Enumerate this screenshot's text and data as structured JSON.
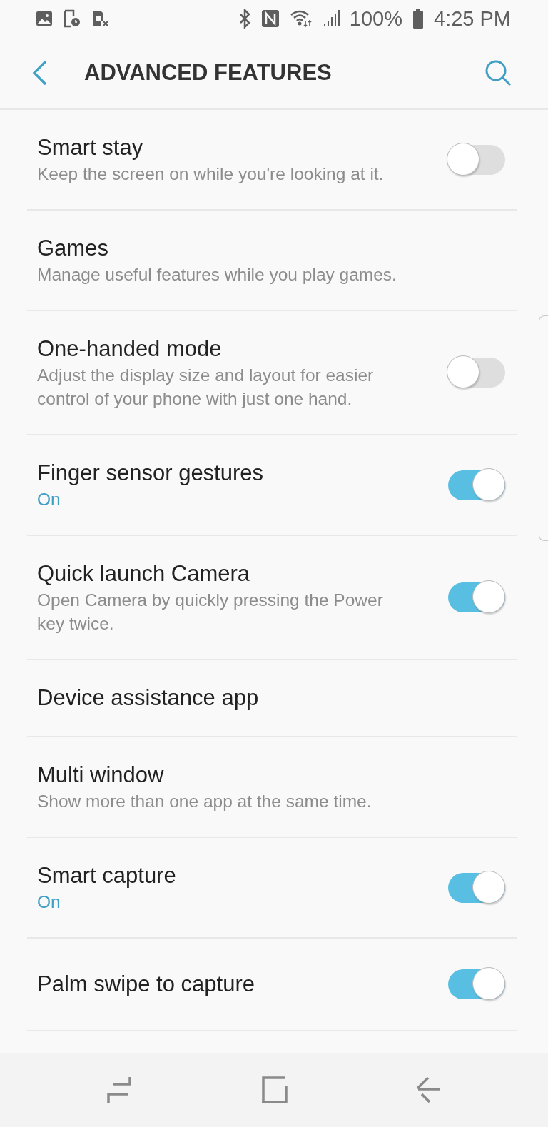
{
  "status_bar": {
    "battery_text": "100%",
    "time": "4:25 PM"
  },
  "header": {
    "title": "ADVANCED FEATURES"
  },
  "settings": [
    {
      "kind": "switch",
      "title": "Smart stay",
      "subtitle": "Keep the screen on while you're looking at it.",
      "on": false,
      "divider": true
    },
    {
      "kind": "link",
      "title": "Games",
      "subtitle": "Manage useful features while you play games."
    },
    {
      "kind": "switch",
      "title": "One-handed mode",
      "subtitle": "Adjust the display size and layout for easier control of your phone with just one hand.",
      "on": false,
      "divider": true
    },
    {
      "kind": "switch",
      "title": "Finger sensor gestures",
      "status": "On",
      "on": true,
      "divider": true
    },
    {
      "kind": "switch",
      "title": "Quick launch Camera",
      "subtitle": "Open Camera by quickly pressing the Power key twice.",
      "on": true,
      "divider": false
    },
    {
      "kind": "link",
      "title": "Device assistance app"
    },
    {
      "kind": "link",
      "title": "Multi window",
      "subtitle": "Show more than one app at the same time."
    },
    {
      "kind": "switch",
      "title": "Smart capture",
      "status": "On",
      "on": true,
      "divider": true
    },
    {
      "kind": "switch",
      "title": "Palm swipe to capture",
      "on": true,
      "divider": true
    }
  ]
}
